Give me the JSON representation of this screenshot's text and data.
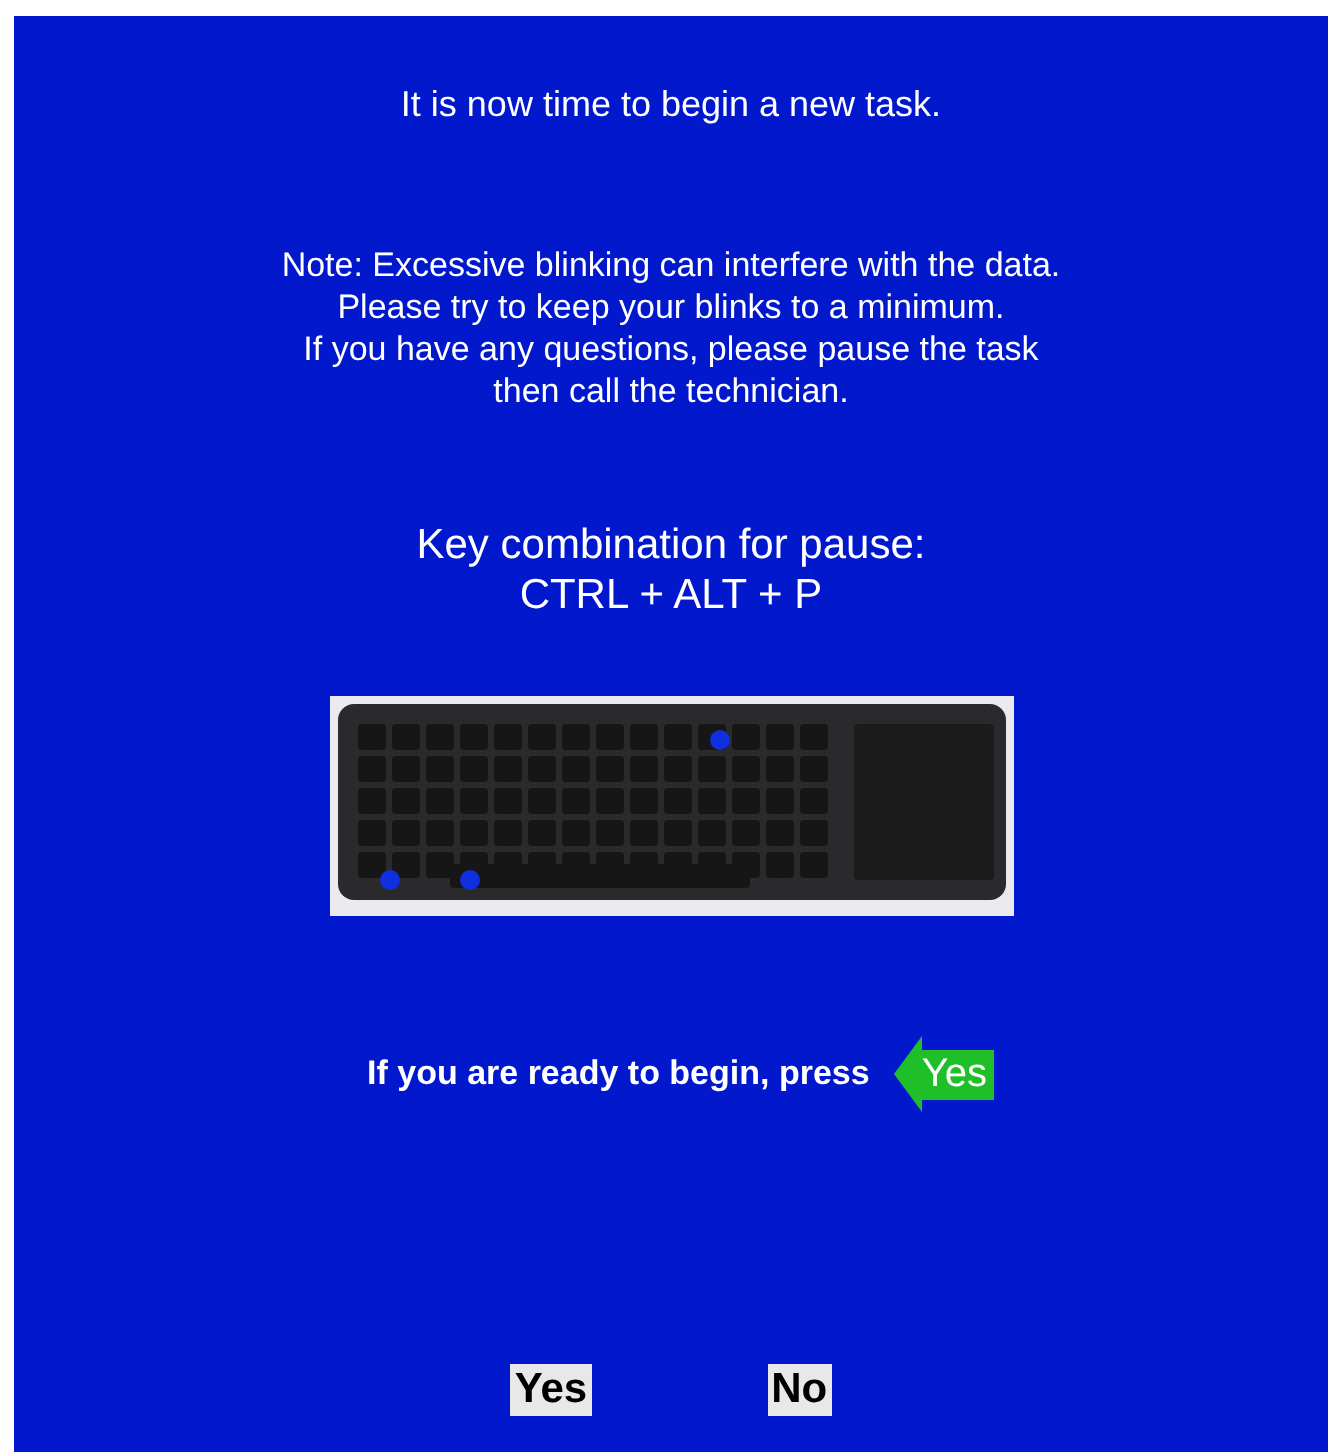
{
  "heading": "It is now time to begin a new task.",
  "note_lines": [
    "Note: Excessive blinking can interfere with the data.",
    "Please try to keep your blinks to a minimum.",
    "If you have any questions, please pause the task",
    "then call the technician."
  ],
  "pause_label": "Key combination for pause:",
  "pause_keys": "CTRL + ALT + P",
  "prompt": "If you are ready to begin, press",
  "prompt_arrow_label": "Yes",
  "buttons": [
    "Yes",
    "No"
  ]
}
